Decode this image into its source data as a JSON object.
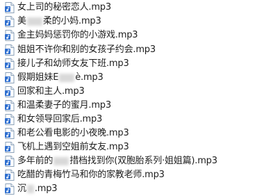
{
  "files": [
    {
      "name": "女上司的秘密恋人.mp3",
      "icon": "mp3-file-icon"
    },
    {
      "name": "美",
      "name_tail": "柔的小妈.mp3",
      "icon": "mp3-file-icon"
    },
    {
      "name": "金主妈妈惩罚你的小游戏.mp3",
      "icon": "mp3-file-icon"
    },
    {
      "name": "姐姐不许你和别的女孩子约会.mp3",
      "icon": "mp3-file-icon"
    },
    {
      "name": "接儿子和幼师女友下班.mp3",
      "icon": "mp3-file-icon"
    },
    {
      "name": "假期姐妹Ε",
      "name_tail": "è.mp3",
      "icon": "mp3-file-icon"
    },
    {
      "name": "回家和主人.mp3",
      "icon": "mp3-file-icon"
    },
    {
      "name": "和温柔妻子的蜜月.mp3",
      "icon": "mp3-file-icon"
    },
    {
      "name": "和女领导回家后.mp3",
      "icon": "mp3-file-icon"
    },
    {
      "name": "和老公看电影的小夜晚.mp3",
      "icon": "mp3-file-icon"
    },
    {
      "name": "飞机上遇到空姐前女友.mp3",
      "icon": "mp3-file-icon"
    },
    {
      "name": "多年前的",
      "name_tail": "措档找到你(双胞胎系列·姐姐篇).mp3",
      "icon": "mp3-file-icon"
    },
    {
      "name": "吃醋的青梅竹马和你的家教老师.mp3",
      "icon": "mp3-file-icon"
    },
    {
      "name": "沉",
      "name_tail": ".mp3",
      "icon": "mp3-file-icon"
    }
  ],
  "colors": {
    "text": "#1e1e1e",
    "icon_blue": "#2f6fcf",
    "background": "#ffffff"
  }
}
